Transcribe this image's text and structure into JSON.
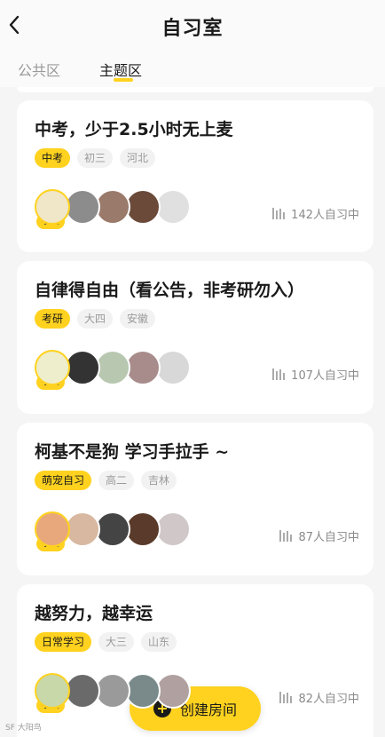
{
  "header": {
    "title": "自习室",
    "back_icon": "chevron-left-icon"
  },
  "tabs": [
    {
      "label": "公共区",
      "active": false
    },
    {
      "label": "主题区",
      "active": true
    }
  ],
  "rooms": [
    {
      "title": "中考，少于2.5小时无上麦",
      "tags": [
        "中考",
        "初三",
        "河北"
      ],
      "badge": "学委",
      "online": "142人自习中",
      "avatar_colors": [
        "#f0e6c8",
        "#8c8c8c",
        "#9a7a6a",
        "#6b4a3a",
        "#e0e0e0"
      ]
    },
    {
      "title": "自律得自由（看公告，非考研勿入）",
      "tags": [
        "考研",
        "大四",
        "安徽"
      ],
      "badge": "学委",
      "online": "107人自习中",
      "avatar_colors": [
        "#eeeecc",
        "#333333",
        "#b8c8b0",
        "#a88c8c",
        "#d8d8d8"
      ]
    },
    {
      "title": "柯基不是狗 学习手拉手 ~",
      "tags": [
        "萌宠自习",
        "高二",
        "吉林"
      ],
      "badge": "学委",
      "online": "87人自习中",
      "avatar_colors": [
        "#e8a87c",
        "#d8b8a0",
        "#444444",
        "#5a3a2a",
        "#d0c8c8"
      ]
    },
    {
      "title": "越努力，越幸运",
      "tags": [
        "日常学习",
        "大三",
        "山东"
      ],
      "badge": "学委",
      "online": "82人自习中",
      "avatar_colors": [
        "#c8d8a8",
        "#6a6a6a",
        "#9a9a9a",
        "#7a8a8a",
        "#b0a0a0"
      ]
    }
  ],
  "fab": {
    "label": "创建房间",
    "icon": "plus-circle-icon"
  },
  "watermark": "SF 大阳鸟"
}
